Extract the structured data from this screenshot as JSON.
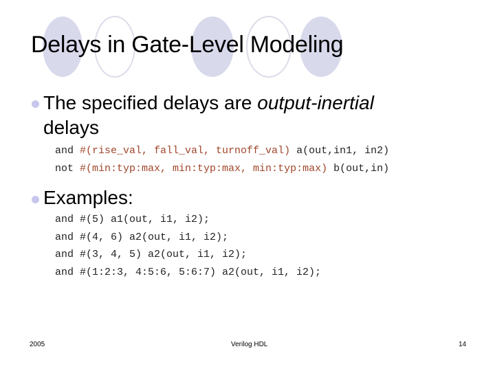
{
  "slide": {
    "title": "Delays in Gate-Level Modeling",
    "bullets": [
      {
        "text_plain": "The specified delays are ",
        "text_italic": "output-inertial",
        "text_line2": "delays",
        "code_lines": [
          {
            "kw": "and ",
            "param": "#(rise_val, fall_val, turnoff_val)",
            "rest": " a(out,in1, in2)"
          },
          {
            "kw": "not ",
            "param": "#(min:typ:max, min:typ:max, min:typ:max)",
            "rest": " b(out,in)"
          }
        ]
      },
      {
        "text_plain": "Examples:",
        "code_lines": [
          "and #(5) a1(out, i1, i2);",
          "and #(4, 6) a2(out, i1, i2);",
          "and #(3, 4, 5) a2(out, i1, i2);",
          "and #(1:2:3, 4:5:6, 5:6:7) a2(out, i1, i2);"
        ]
      }
    ],
    "footer": {
      "left": "2005",
      "center": "Verilog HDL",
      "right": "14"
    },
    "colors": {
      "circle_fill": "#d9d9ec",
      "bullet": "#c7c7ee",
      "code_param": "#a0462a"
    }
  }
}
